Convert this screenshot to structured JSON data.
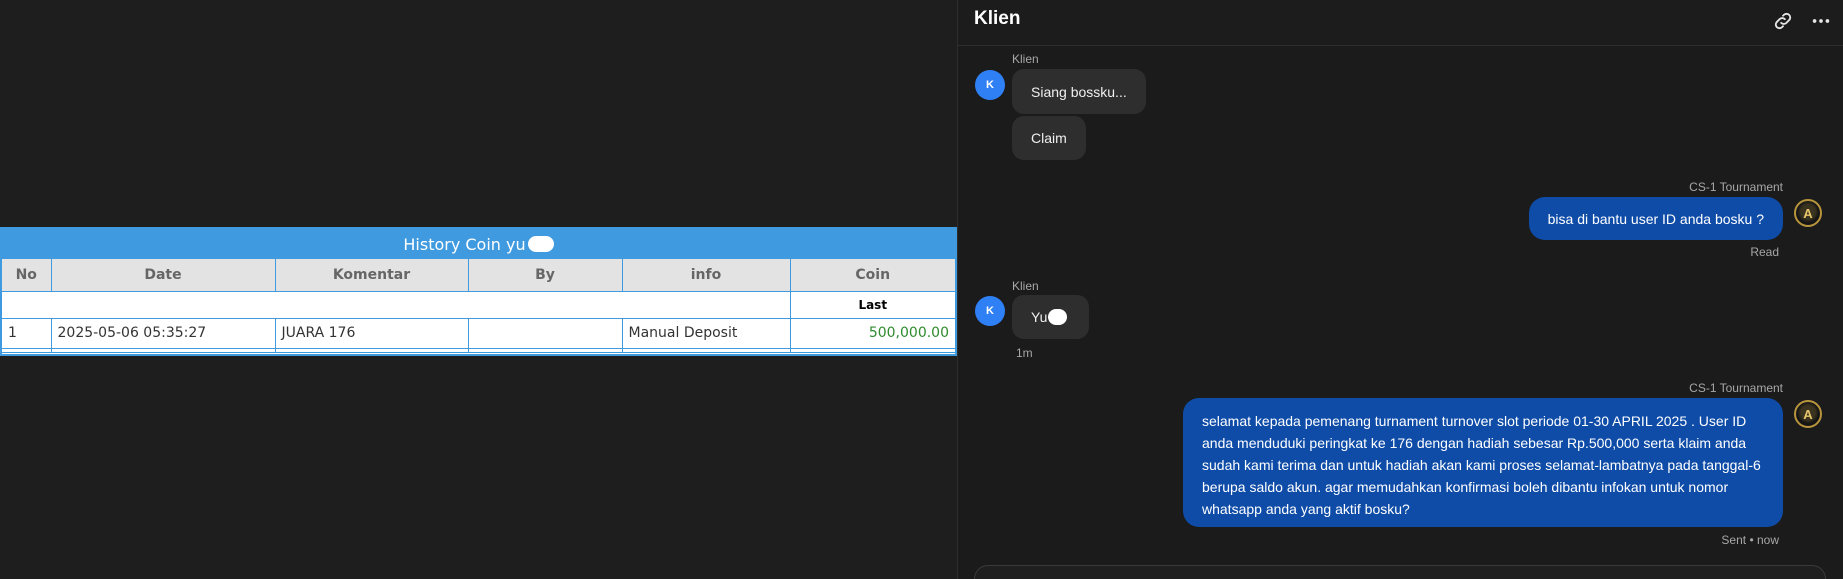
{
  "history": {
    "title": "History Coin yu",
    "columns": [
      "No",
      "Date",
      "Komentar",
      "By",
      "info",
      "Coin"
    ],
    "sub_header": "Last",
    "rows": [
      {
        "no": "1",
        "date": "2025-05-06 05:35:27",
        "komentar": "JUARA 176",
        "by": "",
        "info": "Manual Deposit",
        "coin": "500,000.00"
      }
    ]
  },
  "chat": {
    "title": "Klien",
    "messages": [
      {
        "sender": "Klien",
        "avatar": "K",
        "bubbles": [
          "Siang bossku...",
          "Claim"
        ]
      },
      {
        "sender": "CS-1 Tournament",
        "avatar": "A",
        "text": "bisa di bantu user ID anda bosku ?",
        "status": "Read"
      },
      {
        "sender": "Klien",
        "avatar": "K",
        "text": "Yu",
        "time": "1m"
      },
      {
        "sender": "CS-1 Tournament",
        "avatar": "A",
        "text": "selamat kepada pemenang turnament turnover slot periode 01-30 APRIL 2025 . User ID anda menduduki peringkat ke 176 dengan hadiah sebesar Rp.500,000 serta klaim anda sudah kami terima dan untuk hadiah akan kami proses selamat-lambatnya pada tanggal-6 berupa saldo akun. agar memudahkan konfirmasi boleh dibantu infokan untuk nomor whatsapp anda yang aktif bosku?",
        "status": "Sent • now"
      }
    ]
  },
  "colors": {
    "accent": "#3f9ae0",
    "outgoing_bubble": "#0e4ca8",
    "incoming_bubble": "#2e2e2e",
    "avatar": "#2f80f5",
    "coin_value": "#2e8b2e"
  },
  "icons": {
    "header_link": "link-icon",
    "header_more": "more-horizontal-icon"
  }
}
